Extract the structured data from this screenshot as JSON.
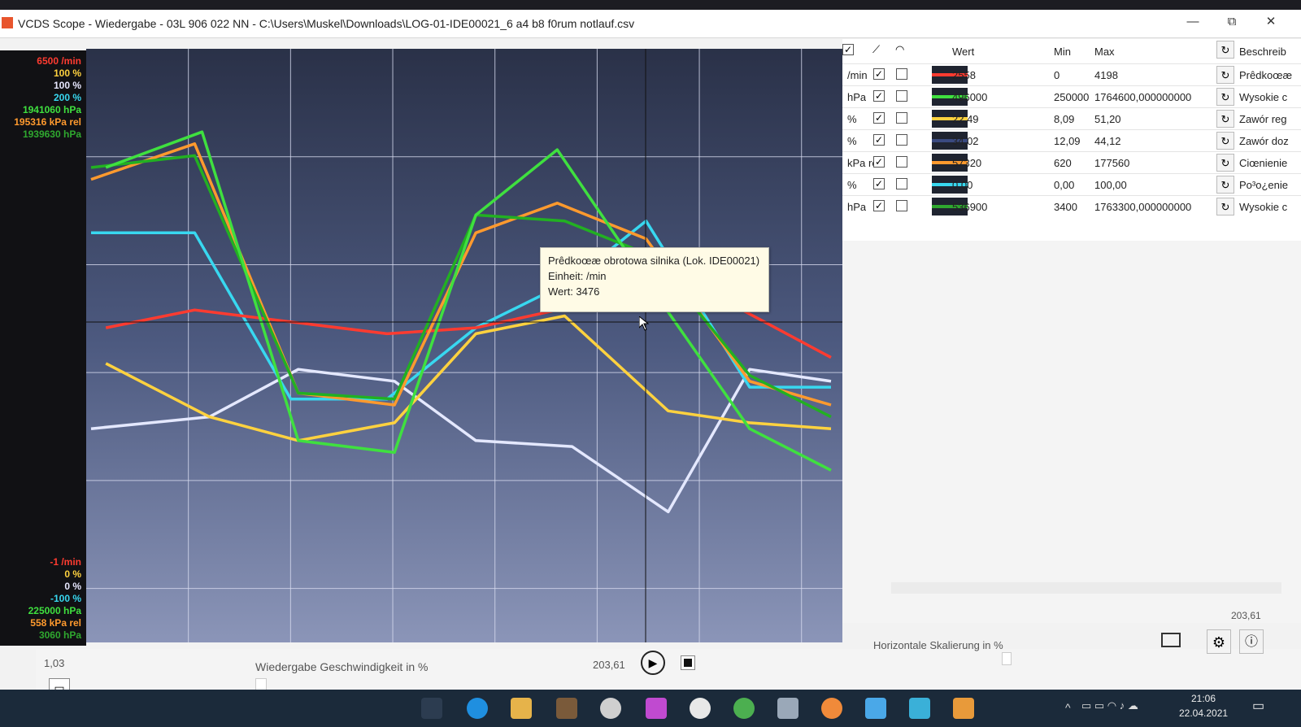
{
  "window": {
    "title": "VCDS Scope - Wiedergabe - 03L 906 022 NN - C:\\Users\\Muskel\\Downloads\\LOG-01-IDE00021_6 a4 b8 f0rum notlauf.csv",
    "minimize": "—",
    "maximize": "⧉",
    "close": "✕"
  },
  "left_scale": {
    "max_labels": [
      {
        "text": "6500 /min",
        "color": "#ff3b30"
      },
      {
        "text": "100 %",
        "color": "#ffd23f"
      },
      {
        "text": "100 %",
        "color": "#e8e8ff"
      },
      {
        "text": "200 %",
        "color": "#38d8f0"
      },
      {
        "text": "1941060 hPa",
        "color": "#3fe03f"
      },
      {
        "text": "195316 kPa rel",
        "color": "#ff9a2e"
      },
      {
        "text": "1939630 hPa",
        "color": "#2fa82f"
      }
    ],
    "min_labels": [
      {
        "text": "-1 /min",
        "color": "#ff3b30"
      },
      {
        "text": "0 %",
        "color": "#ffd23f"
      },
      {
        "text": "0 %",
        "color": "#e8e8ff"
      },
      {
        "text": "-100 %",
        "color": "#38d8f0"
      },
      {
        "text": "225000 hPa",
        "color": "#3fe03f"
      },
      {
        "text": "558 kPa rel",
        "color": "#ff9a2e"
      },
      {
        "text": "3060 hPa",
        "color": "#2fa82f"
      }
    ]
  },
  "plot": {
    "series": [
      {
        "id": "white",
        "color": "#e4e8ff",
        "points": [
          [
            0,
            0.64
          ],
          [
            0.16,
            0.62
          ],
          [
            0.28,
            0.54
          ],
          [
            0.41,
            0.56
          ],
          [
            0.52,
            0.66
          ],
          [
            0.65,
            0.67
          ],
          [
            0.78,
            0.78
          ],
          [
            0.89,
            0.54
          ],
          [
            1,
            0.56
          ]
        ]
      },
      {
        "id": "yellow",
        "color": "#ffd23f",
        "points": [
          [
            0.02,
            0.53
          ],
          [
            0.16,
            0.62
          ],
          [
            0.28,
            0.66
          ],
          [
            0.41,
            0.63
          ],
          [
            0.52,
            0.48
          ],
          [
            0.64,
            0.45
          ],
          [
            0.78,
            0.61
          ],
          [
            0.89,
            0.63
          ],
          [
            1,
            0.64
          ]
        ]
      },
      {
        "id": "cyan",
        "color": "#38d8f0",
        "points": [
          [
            0,
            0.31
          ],
          [
            0.14,
            0.31
          ],
          [
            0.27,
            0.59
          ],
          [
            0.4,
            0.59
          ],
          [
            0.52,
            0.47
          ],
          [
            0.65,
            0.39
          ],
          [
            0.75,
            0.29
          ],
          [
            0.89,
            0.57
          ],
          [
            1,
            0.57
          ]
        ]
      },
      {
        "id": "red",
        "color": "#ff3b30",
        "points": [
          [
            0.02,
            0.47
          ],
          [
            0.14,
            0.44
          ],
          [
            0.27,
            0.46
          ],
          [
            0.4,
            0.48
          ],
          [
            0.52,
            0.47
          ],
          [
            0.63,
            0.44
          ],
          [
            0.76,
            0.42
          ],
          [
            0.88,
            0.44
          ],
          [
            1,
            0.52
          ]
        ]
      },
      {
        "id": "orange",
        "color": "#ff9a2e",
        "points": [
          [
            0,
            0.22
          ],
          [
            0.14,
            0.16
          ],
          [
            0.28,
            0.58
          ],
          [
            0.41,
            0.6
          ],
          [
            0.52,
            0.31
          ],
          [
            0.63,
            0.26
          ],
          [
            0.75,
            0.32
          ],
          [
            0.89,
            0.56
          ],
          [
            1,
            0.6
          ]
        ]
      },
      {
        "id": "darkgreen",
        "color": "#22b022",
        "points": [
          [
            0,
            0.2
          ],
          [
            0.14,
            0.18
          ],
          [
            0.28,
            0.58
          ],
          [
            0.41,
            0.59
          ],
          [
            0.52,
            0.28
          ],
          [
            0.64,
            0.29
          ],
          [
            0.76,
            0.35
          ],
          [
            0.89,
            0.55
          ],
          [
            1,
            0.62
          ]
        ]
      },
      {
        "id": "green",
        "color": "#3fe03f",
        "points": [
          [
            0.02,
            0.2
          ],
          [
            0.15,
            0.14
          ],
          [
            0.28,
            0.66
          ],
          [
            0.41,
            0.68
          ],
          [
            0.52,
            0.28
          ],
          [
            0.63,
            0.17
          ],
          [
            0.75,
            0.39
          ],
          [
            0.89,
            0.64
          ],
          [
            1,
            0.71
          ]
        ]
      }
    ],
    "tooltip": {
      "line1": "Prêdkoœæ obrotowa silnika (Lok. IDE00021)",
      "line2": "Einheit:  /min",
      "line3": "Wert: 3476"
    }
  },
  "table": {
    "headers": {
      "wert": "Wert",
      "min": "Min",
      "max": "Max",
      "beschreib": "Beschreib"
    },
    "rows": [
      {
        "unit": "/min",
        "color": "#ff3b30",
        "wert": "2558",
        "min": "0",
        "max": "4198",
        "desc": "Prêdkoœæ"
      },
      {
        "unit": "hPa",
        "color": "#3fe03f",
        "wert": "496000",
        "min": "250000",
        "max": "1764600,000000000",
        "desc": "Wysokie c"
      },
      {
        "unit": "%",
        "color": "#ffd23f",
        "wert": "22,49",
        "min": "8,09",
        "max": "51,20",
        "desc": "Zawór reg"
      },
      {
        "unit": "%",
        "color": "#3a4a80",
        "wert": "34,02",
        "min": "12,09",
        "max": "44,12",
        "desc": "Zawór doz"
      },
      {
        "unit": "kPa rel",
        "color": "#ff9a2e",
        "wert": "57320",
        "min": "620",
        "max": "177560",
        "desc": "Ciœnienie"
      },
      {
        "unit": "%",
        "color": "#38d8f0",
        "wert": "0,00",
        "min": "0,00",
        "max": "100,00",
        "desc": "Po³o¿enie"
      },
      {
        "unit": "hPa",
        "color": "#2fa82f",
        "wert": "536900",
        "min": "3400",
        "max": "1763300,000000000",
        "desc": "Wysokie c"
      }
    ]
  },
  "bottom": {
    "left_value": "1,03",
    "speed_label": "Wiedergabe Geschwindigkeit in %",
    "position_value": "203,61",
    "horizontal_label": "Horizontale Skalierung in %",
    "right_value": "203,61"
  },
  "taskbar": {
    "time": "21:06",
    "date": "22.04.2021"
  }
}
